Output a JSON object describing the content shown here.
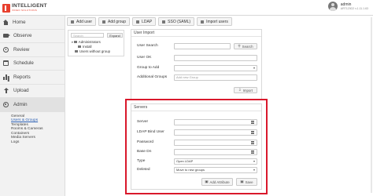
{
  "header": {
    "logo_line1": "INTELLIGENT",
    "logo_line2": "VIDEO SOLUTIONS",
    "user_name": "admin",
    "user_version": "ART123G2 v.1.11.1.63",
    "brand_color": "#e8402e"
  },
  "sidebar": {
    "items": [
      {
        "label": "Home",
        "icon": "home-icon"
      },
      {
        "label": "Observe",
        "icon": "camera-icon"
      },
      {
        "label": "Review",
        "icon": "clock-icon"
      },
      {
        "label": "Schedule",
        "icon": "calendar-icon"
      },
      {
        "label": "Reports",
        "icon": "bar-chart-icon"
      },
      {
        "label": "Upload",
        "icon": "upload-icon"
      },
      {
        "label": "Admin",
        "icon": "gear-icon"
      }
    ],
    "sub_items": [
      "General",
      "Users & Groups",
      "Templates",
      "Rooms & Cameras",
      "Containers",
      "Media Servers",
      "Logs"
    ],
    "active_sub": "Users & Groups"
  },
  "toolbar": {
    "add_user": "Add user",
    "add_group": "Add group",
    "ldap": "LDAP",
    "sso": "SSO (SAML)",
    "import_users": "Import users"
  },
  "tree": {
    "search_placeholder": "Search",
    "expand_label": "Expand",
    "administrators": "Administrators",
    "install": "Install",
    "users_without_group": "Users without group"
  },
  "user_import": {
    "title": "User Import",
    "user_search_label": "User Search",
    "user_ok_label": "User OK",
    "group_to_add_label": "Group to Add",
    "additional_groups_label": "Additional Groups",
    "search_button": "Search",
    "add_new_group_placeholder": "Add new Group",
    "import_button": "Import"
  },
  "servers": {
    "title": "Servers",
    "server_label": "Server",
    "ldap_bind_user_label": "LDAP Bind User",
    "password_label": "Password",
    "base_dn_label": "Base Dn",
    "type_label": "Type",
    "type_value": "Open LDAP",
    "deleted_label": "Deleted",
    "deleted_value": "Move to new groups",
    "add_attribute_button": "Add Attribute",
    "save_button": "Save",
    "highlight_color": "#d9182b"
  }
}
